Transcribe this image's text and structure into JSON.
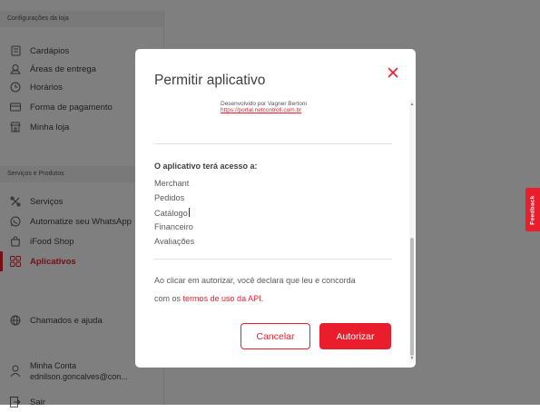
{
  "colors": {
    "accent": "#ea1d2c",
    "overlay": "rgba(0,0,0,0.5)"
  },
  "sidebar": {
    "section_store": "Configurações da loja",
    "store_items": [
      {
        "label": "Cardápios",
        "icon": "menu-book-icon"
      },
      {
        "label": "Áreas de entrega",
        "icon": "location-icon"
      },
      {
        "label": "Horários",
        "icon": "clock-icon"
      },
      {
        "label": "Forma de pagamento",
        "icon": "card-icon"
      },
      {
        "label": "Minha loja",
        "icon": "store-icon"
      }
    ],
    "section_services": "Serviços e Produtos",
    "service_items": [
      {
        "label": "Serviços",
        "icon": "tools-icon"
      },
      {
        "label": "Automatize seu WhatsApp",
        "icon": "whatsapp-icon"
      },
      {
        "label": "iFood Shop",
        "icon": "shopping-bag-icon"
      },
      {
        "label": "Aplicativos",
        "icon": "apps-grid-icon",
        "active": true
      }
    ],
    "help_item": {
      "label": "Chamados e ajuda",
      "icon": "globe-icon"
    },
    "account": {
      "name": "Minha Conta",
      "email": "ednilson.goncalves@con...",
      "icon": "user-icon"
    },
    "logout": {
      "label": "Sair",
      "icon": "logout-icon"
    }
  },
  "feedback_tab": "Feedback",
  "modal": {
    "title": "Permitir aplicativo",
    "developer_by": "Desenvolvido por Vagner Bertoni",
    "developer_link": "https://portal.netcontroll.com.br",
    "access_title": "O aplicativo terá acesso a:",
    "permissions": [
      "Merchant",
      "Pedidos",
      "Catálogo",
      "Financeiro",
      "Avaliações"
    ],
    "consent_line1": "Ao clicar em autorizar, você declara que leu e concorda",
    "consent_prefix": "com os",
    "consent_link": "termos de uso da API",
    "consent_suffix": ".",
    "cancel_label": "Cancelar",
    "authorize_label": "Autorizar"
  }
}
